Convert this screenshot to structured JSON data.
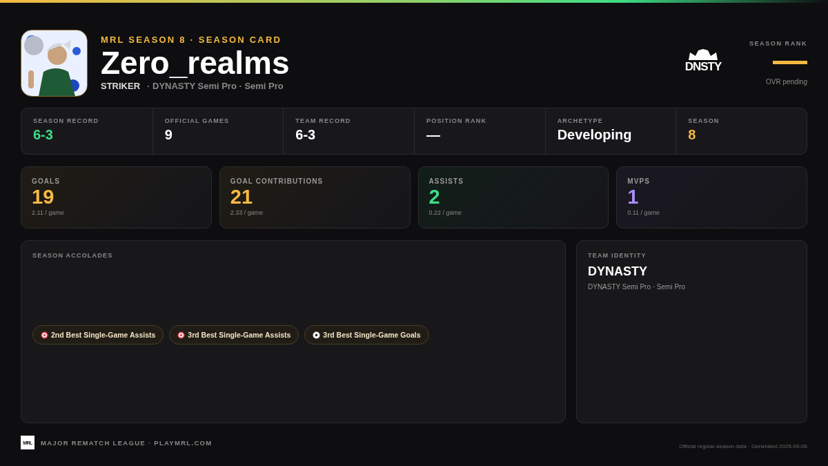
{
  "header": {
    "eyebrow": "MRL SEASON 8 · SEASON CARD",
    "player_name": "Zero_realms",
    "position": "STRIKER",
    "team_line": "· DYNASTY Semi Pro · Semi Pro",
    "team_logo_text": "DNSTY",
    "season_rank": {
      "label": "SEASON RANK",
      "note": "OVR pending"
    }
  },
  "summary": [
    {
      "label": "SEASON RECORD",
      "value": "6-3",
      "color": "#3ddc84"
    },
    {
      "label": "OFFICIAL GAMES",
      "value": "9",
      "color": "#ffffff"
    },
    {
      "label": "TEAM RECORD",
      "value": "6-3",
      "color": "#ffffff"
    },
    {
      "label": "POSITION RANK",
      "value": "—",
      "color": "#ffffff"
    },
    {
      "label": "ARCHETYPE",
      "value": "Developing",
      "color": "#ffffff"
    },
    {
      "label": "SEASON",
      "value": "8",
      "color": "#f5b942"
    }
  ],
  "stats": [
    {
      "label": "GOALS",
      "value": "19",
      "per_game": "2.11 / game",
      "color": "#f5b942"
    },
    {
      "label": "GOAL CONTRIBUTIONS",
      "value": "21",
      "per_game": "2.33 / game",
      "color": "#f5b942"
    },
    {
      "label": "ASSISTS",
      "value": "2",
      "per_game": "0.22 / game",
      "color": "#3ddc84"
    },
    {
      "label": "MVPS",
      "value": "1",
      "per_game": "0.11 / game",
      "color": "#a98bf5"
    }
  ],
  "accolades": {
    "title": "SEASON ACCOLADES",
    "items": [
      {
        "kind": "target",
        "label": "2nd Best Single-Game Assists"
      },
      {
        "kind": "target",
        "label": "3rd Best Single-Game Assists"
      },
      {
        "kind": "ball",
        "label": "3rd Best Single-Game Goals"
      }
    ]
  },
  "team_identity": {
    "title": "TEAM IDENTITY",
    "name": "DYNASTY",
    "subtitle": "DYNASTY Semi Pro · Semi Pro"
  },
  "footer": {
    "logo_text": "MRL",
    "league": "MAJOR REMATCH LEAGUE · PLAYMRL.COM",
    "note": "Official regular-season data · Generated 2026-09-06"
  }
}
